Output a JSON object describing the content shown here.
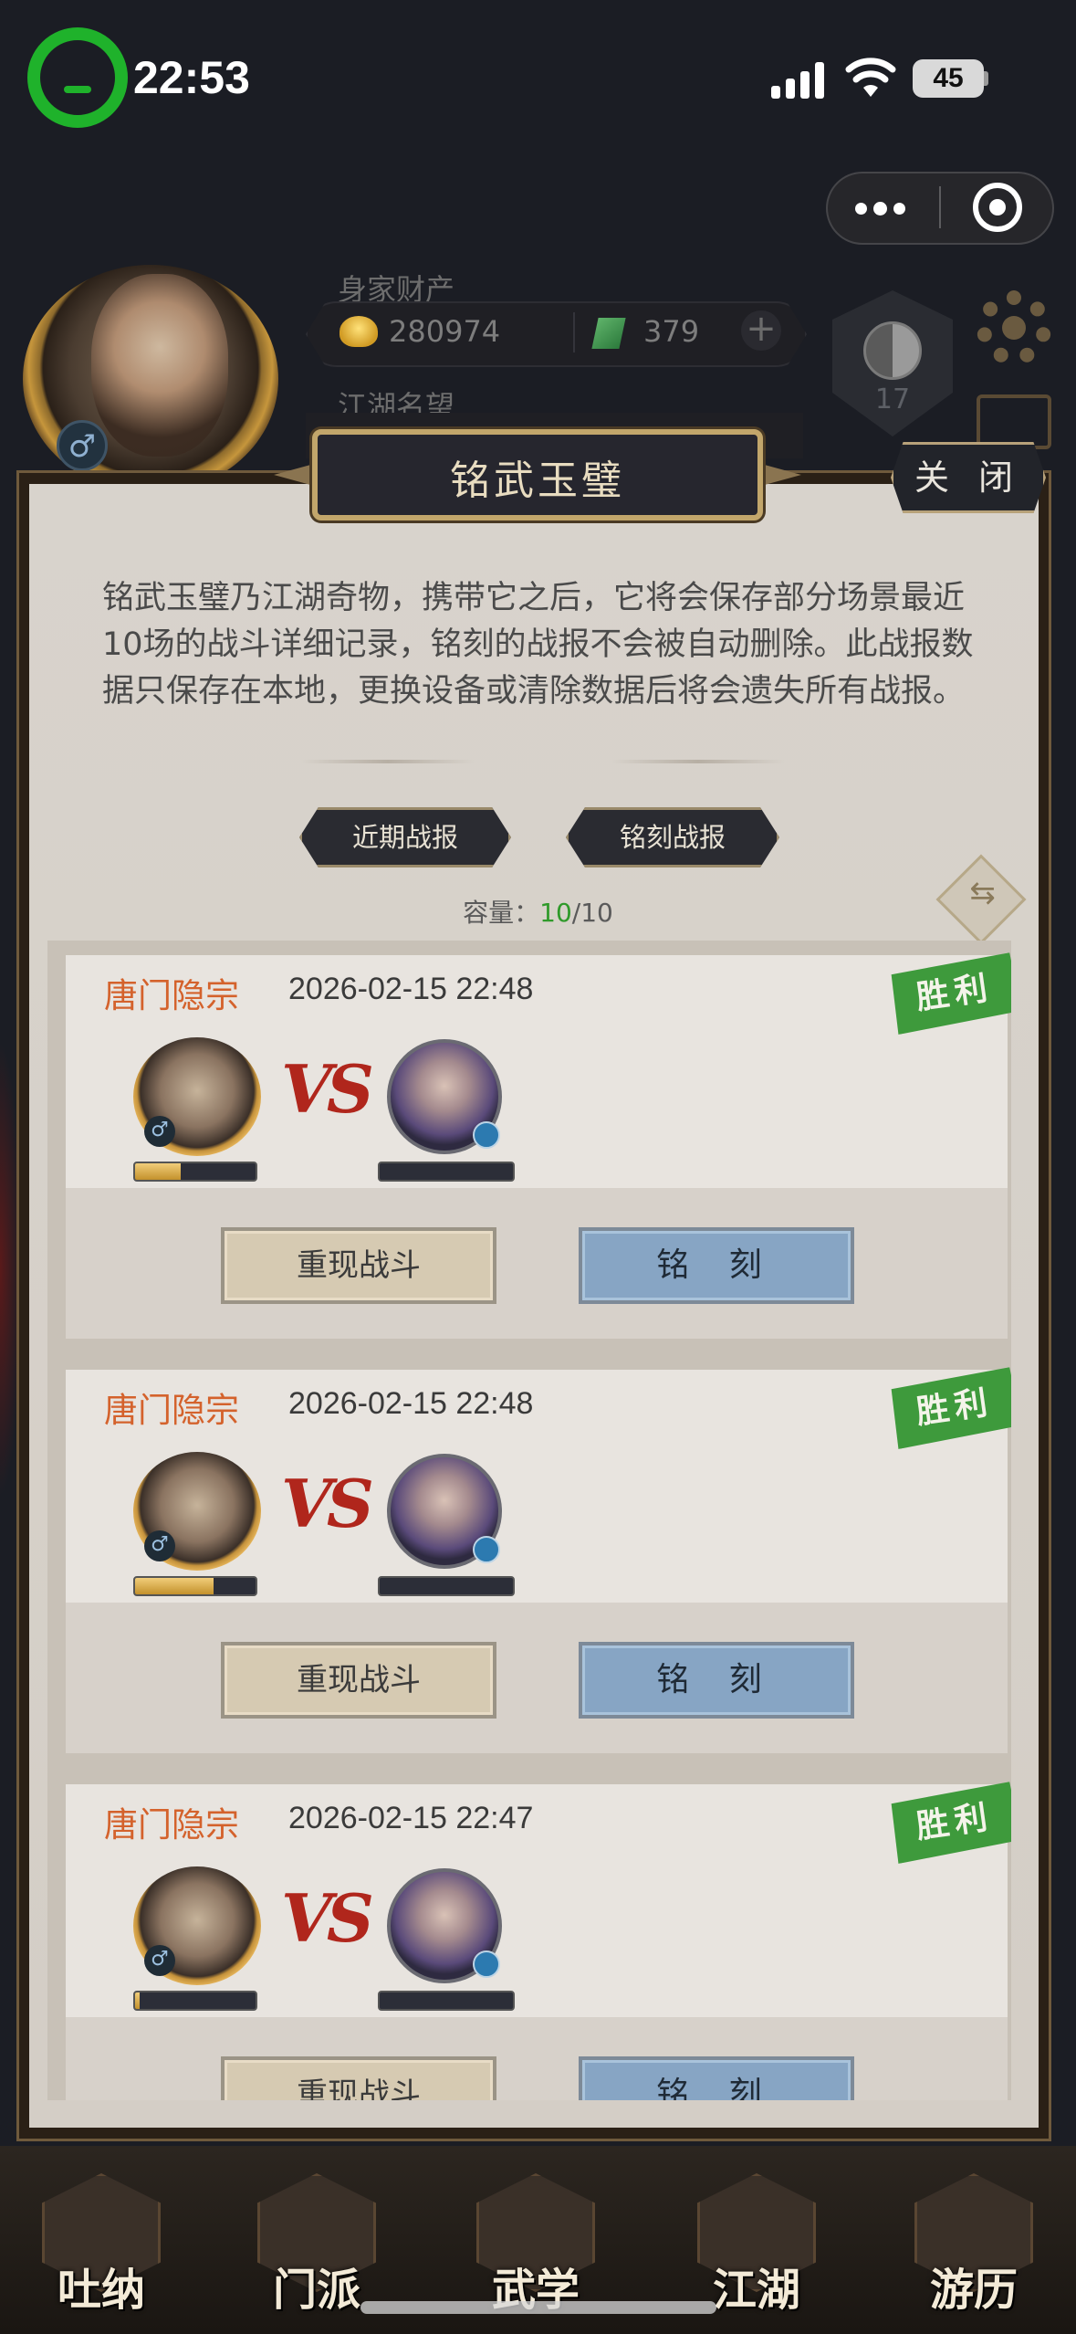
{
  "status_bar": {
    "time": "22:53",
    "battery": "45"
  },
  "header": {
    "wealth_label": "身家财产",
    "gold": "280974",
    "jade": "379",
    "plus": "+",
    "fame_label": "江湖名望",
    "level": "17",
    "gender": "♂"
  },
  "modal": {
    "title": "铭武玉璧",
    "close_label": "关 闭",
    "description": "铭武玉璧乃江湖奇物，携带它之后，它将会保存部分场景最近10场的战斗详细记录，铭刻的战报不会被自动删除。此战报数据只保存在本地，更换设备或清除数据后将会遗失所有战报。",
    "tabs": {
      "recent": "近期战报",
      "engraved": "铭刻战报"
    },
    "capacity": {
      "label": "容量：",
      "current": "10",
      "total": "/10"
    }
  },
  "battles": [
    {
      "sect": "唐门隐宗",
      "datetime": "2026-02-15 22:48",
      "result": "胜利",
      "player_hp": 0.38,
      "replay_label": "重现战斗",
      "engrave_label": "铭 刻"
    },
    {
      "sect": "唐门隐宗",
      "datetime": "2026-02-15 22:48",
      "result": "胜利",
      "player_hp": 0.65,
      "replay_label": "重现战斗",
      "engrave_label": "铭 刻"
    },
    {
      "sect": "唐门隐宗",
      "datetime": "2026-02-15 22:47",
      "result": "胜利",
      "player_hp": 0.04,
      "replay_label": "重现战斗",
      "engrave_label": "铭 刻"
    }
  ],
  "vs_text": "VS",
  "bottom_nav": [
    {
      "label": "吐纳",
      "icon": "breathing-icon"
    },
    {
      "label": "门派",
      "icon": "sect-icon"
    },
    {
      "label": "武学",
      "icon": "martial-arts-icon"
    },
    {
      "label": "江湖",
      "icon": "jianghu-icon"
    },
    {
      "label": "游历",
      "icon": "travel-icon"
    }
  ]
}
